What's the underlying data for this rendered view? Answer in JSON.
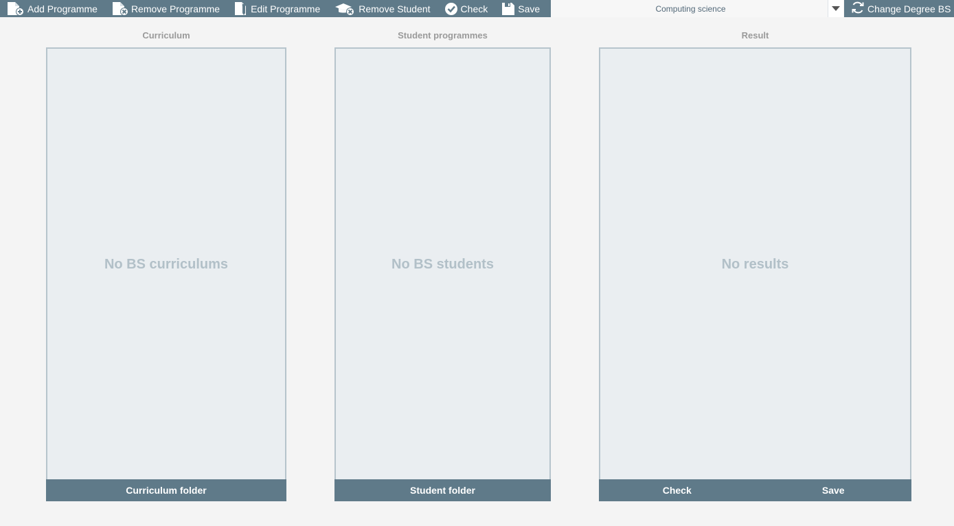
{
  "toolbar": {
    "add_programme": "Add Programme",
    "remove_programme": "Remove Programme",
    "edit_programme": "Edit Programme",
    "remove_student": "Remove Student",
    "check": "Check",
    "save": "Save"
  },
  "degree_select": {
    "value": "Computing science"
  },
  "change_degree": "Change Degree BS",
  "columns": {
    "curriculum": {
      "title": "Curriculum",
      "empty": "No BS curriculums",
      "footer_button": "Curriculum folder"
    },
    "students": {
      "title": "Student programmes",
      "empty": "No BS students",
      "footer_button": "Student folder"
    },
    "result": {
      "title": "Result",
      "empty": "No results",
      "check_button": "Check",
      "save_button": "Save"
    }
  },
  "colors": {
    "toolbar": "#5f7a89",
    "panel_bg": "#eaeef1",
    "panel_border": "#b6c4cc",
    "empty_text": "#b2c0c8",
    "page_bg": "#f4f4f4"
  },
  "icons": {
    "add_programme": "document-add-icon",
    "remove_programme": "document-remove-icon",
    "edit_programme": "document-edit-icon",
    "remove_student": "graduation-cap-remove-icon",
    "check": "check-circle-icon",
    "save": "floppy-disk-icon",
    "dropdown": "caret-down-icon",
    "change_degree": "refresh-icon"
  }
}
